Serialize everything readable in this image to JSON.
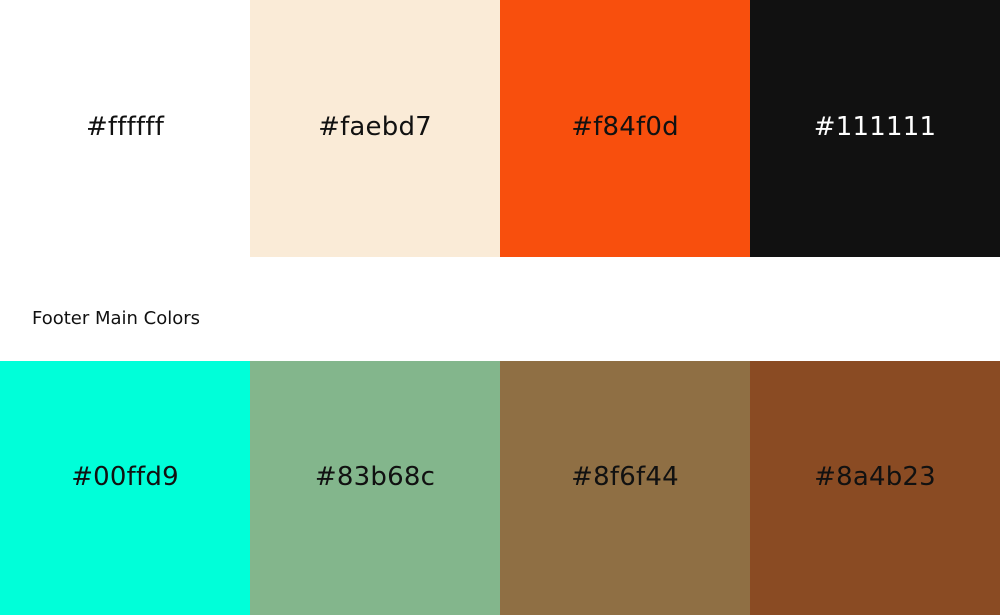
{
  "header_swatches": [
    {
      "hex": "#ffffff",
      "label": "#ffffff",
      "text_color": "#111111"
    },
    {
      "hex": "#faebd7",
      "label": "#faebd7",
      "text_color": "#111111"
    },
    {
      "hex": "#f84f0d",
      "label": "#f84f0d",
      "text_color": "#111111"
    },
    {
      "hex": "#111111",
      "label": "#111111",
      "text_color": "#ffffff"
    }
  ],
  "footer_section": {
    "title": "Footer Main Colors",
    "swatches": [
      {
        "hex": "#00ffd9",
        "label": "#00ffd9",
        "text_color": "#111111"
      },
      {
        "hex": "#83b68c",
        "label": "#83b68c",
        "text_color": "#111111"
      },
      {
        "hex": "#8f6f44",
        "label": "#8f6f44",
        "text_color": "#111111"
      },
      {
        "hex": "#8a4b23",
        "label": "#8a4b23",
        "text_color": "#111111"
      }
    ]
  }
}
